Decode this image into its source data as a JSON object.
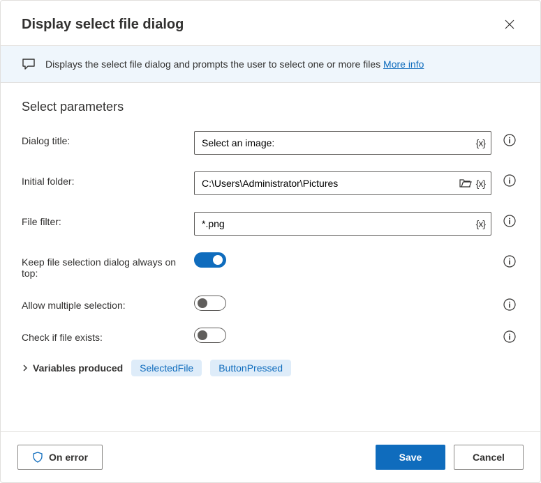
{
  "header": {
    "title": "Display select file dialog"
  },
  "banner": {
    "text": "Displays the select file dialog and prompts the user to select one or more files ",
    "link_label": "More info"
  },
  "section_title": "Select parameters",
  "params": {
    "dialog_title": {
      "label": "Dialog title:",
      "value": "Select an image:"
    },
    "initial_folder": {
      "label": "Initial folder:",
      "value": "C:\\Users\\Administrator\\Pictures"
    },
    "file_filter": {
      "label": "File filter:",
      "value": "*.png"
    },
    "always_on_top": {
      "label": "Keep file selection dialog always on top:",
      "value": true
    },
    "allow_multiple": {
      "label": "Allow multiple selection:",
      "value": false
    },
    "check_exists": {
      "label": "Check if file exists:",
      "value": false
    }
  },
  "variables": {
    "label": "Variables produced",
    "items": [
      "SelectedFile",
      "ButtonPressed"
    ]
  },
  "footer": {
    "on_error": "On error",
    "save": "Save",
    "cancel": "Cancel"
  }
}
